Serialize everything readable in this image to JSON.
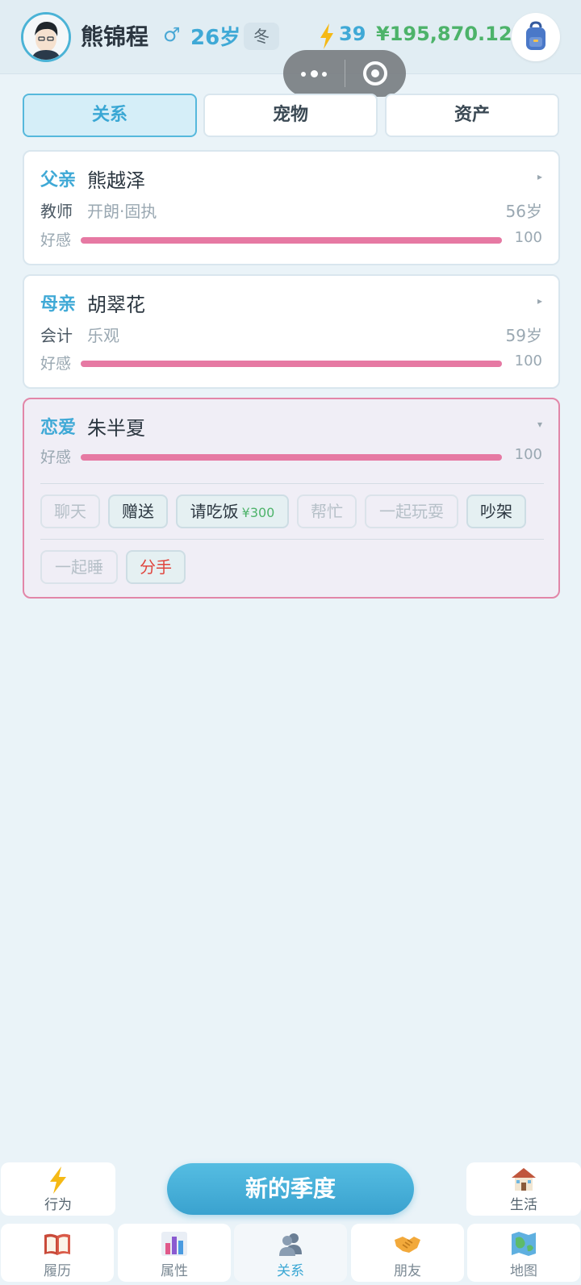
{
  "header": {
    "name": "熊锦程",
    "gender_symbol": "♂",
    "age": "26岁",
    "season": "冬",
    "energy": "39",
    "money": "¥195,870.125"
  },
  "tabs": [
    {
      "label": "关系",
      "active": true
    },
    {
      "label": "宠物",
      "active": false
    },
    {
      "label": "资产",
      "active": false
    }
  ],
  "relations": [
    {
      "role": "父亲",
      "name": "熊越泽",
      "job": "教师",
      "traits": "开朗·固执",
      "age": "56岁",
      "affection_label": "好感",
      "affection": "100",
      "affection_fraction": 1.0
    },
    {
      "role": "母亲",
      "name": "胡翠花",
      "job": "会计",
      "traits": "乐观",
      "age": "59岁",
      "affection_label": "好感",
      "affection": "100",
      "affection_fraction": 1.0
    },
    {
      "role": "恋爱",
      "name": "朱半夏",
      "affection_label": "好感",
      "affection": "100",
      "affection_fraction": 1.0,
      "actions": [
        {
          "label": "聊天",
          "enabled": false
        },
        {
          "label": "赠送",
          "enabled": true
        },
        {
          "label": "请吃饭",
          "price": "¥300",
          "enabled": true
        },
        {
          "label": "帮忙",
          "enabled": false
        },
        {
          "label": "一起玩耍",
          "enabled": false
        },
        {
          "label": "吵架",
          "enabled": true
        },
        {
          "label": "一起睡",
          "enabled": false
        },
        {
          "label": "分手",
          "enabled": true
        }
      ]
    }
  ],
  "bottom": {
    "action_label": "行为",
    "new_season": "新的季度",
    "life_label": "生活",
    "nav": [
      {
        "label": "履历",
        "icon": "book-icon"
      },
      {
        "label": "属性",
        "icon": "bar-chart-icon"
      },
      {
        "label": "关系",
        "icon": "people-icon",
        "active": true
      },
      {
        "label": "朋友",
        "icon": "handshake-icon"
      },
      {
        "label": "地图",
        "icon": "map-icon"
      }
    ]
  },
  "colors": {
    "accent": "#3fa9d6",
    "money": "#4db36a",
    "affection": "#e679a3",
    "danger": "#e0463f",
    "romance_border": "#e286a8"
  }
}
